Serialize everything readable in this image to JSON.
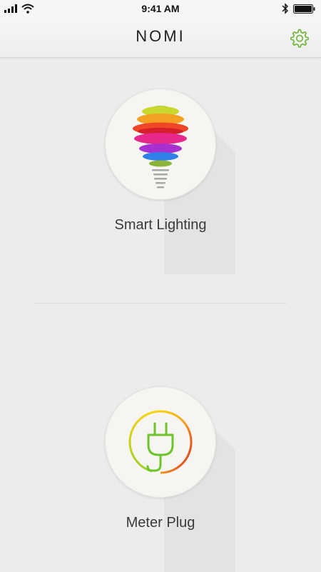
{
  "status_bar": {
    "time": "9:41 AM",
    "icons": [
      "signal-icon",
      "wifi-icon",
      "bluetooth-icon",
      "battery-icon"
    ]
  },
  "header": {
    "title": "NOMI",
    "settings_icon": "gear-icon",
    "accent_color": "#7ab648"
  },
  "devices": [
    {
      "label": "Smart Lighting",
      "icon": "rainbow-bulb-icon"
    },
    {
      "label": "Meter Plug",
      "icon": "plug-icon"
    }
  ],
  "colors": {
    "background": "#ececec",
    "card": "#f6f5f1",
    "plug_green": "#6cc52a",
    "ring_start": "#f5d40b",
    "ring_end": "#d9281f"
  }
}
